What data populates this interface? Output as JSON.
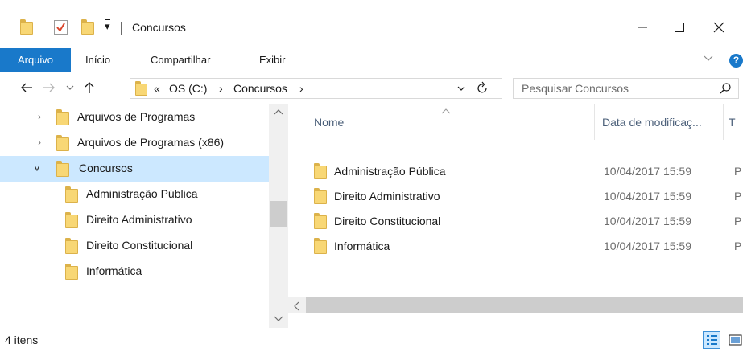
{
  "window": {
    "title": "Concursos",
    "minimize_glyph": "—",
    "maximize_glyph": "☐",
    "close_glyph": "✕"
  },
  "quick_access": {
    "customize_glyph": "▾"
  },
  "ribbon": {
    "tabs": [
      "Arquivo",
      "Início",
      "Compartilhar",
      "Exibir"
    ],
    "help_label": "?"
  },
  "address": {
    "overflow": "«",
    "crumbs": [
      "OS (C:)",
      "Concursos"
    ],
    "separator": "›"
  },
  "search": {
    "placeholder": "Pesquisar Concursos"
  },
  "nav_pane": {
    "items": [
      {
        "label": "Arquivos de Programas",
        "expander": "›"
      },
      {
        "label": "Arquivos de Programas (x86)",
        "expander": "›"
      },
      {
        "label": "Concursos",
        "expander": "˅"
      },
      {
        "label": "Administração Pública",
        "expander": ""
      },
      {
        "label": "Direito Administrativo",
        "expander": ""
      },
      {
        "label": "Direito Constitucional",
        "expander": ""
      },
      {
        "label": "Informática",
        "expander": ""
      }
    ]
  },
  "content": {
    "columns": {
      "name": "Nome",
      "date": "Data de modificaç...",
      "type": "T"
    },
    "files": [
      {
        "name": "Administração Pública",
        "date": "10/04/2017 15:59",
        "type": "P"
      },
      {
        "name": "Direito Administrativo",
        "date": "10/04/2017 15:59",
        "type": "P"
      },
      {
        "name": "Direito Constitucional",
        "date": "10/04/2017 15:59",
        "type": "P"
      },
      {
        "name": "Informática",
        "date": "10/04/2017 15:59",
        "type": "P"
      }
    ]
  },
  "status": {
    "item_count": "4 itens"
  },
  "colors": {
    "accent": "#1979ca",
    "selection": "#cce8ff",
    "folder": "#f8d775"
  }
}
